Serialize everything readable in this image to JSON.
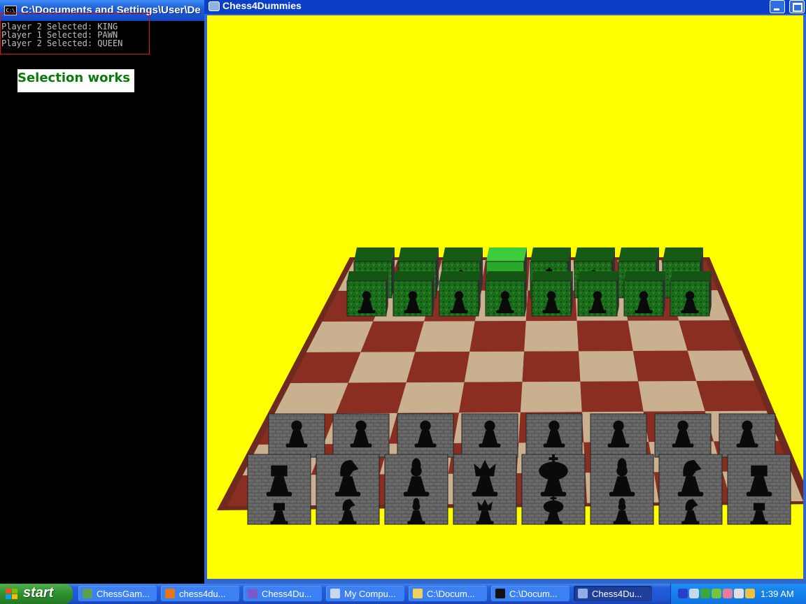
{
  "console": {
    "title": "C:\\Documents and Settings\\User\\De",
    "icon_label": "C:\\",
    "lines": [
      "Player 2 Selected: KING",
      "Player 1 Selected: PAWN",
      "Player 2 Selected: QUEEN"
    ],
    "annotation": "Selection works"
  },
  "chess_window": {
    "title": "Chess4Dummies",
    "background_color": "#ffff00",
    "board": {
      "light_square": "#c9b08e",
      "dark_square": "#8a2e22",
      "player1_color": "#1a6b1a",
      "player2_color": "#6a6a6a",
      "back_rank": [
        "rook",
        "knight",
        "bishop",
        "queen",
        "king",
        "bishop",
        "knight",
        "rook"
      ],
      "selected_piece_front": "king",
      "selected_piece_back": "queen"
    }
  },
  "taskbar": {
    "start_label": "start",
    "tasks": [
      {
        "label": "ChessGam...",
        "icon": "app-icon",
        "color": "#5aa05a"
      },
      {
        "label": "chess4du...",
        "icon": "firefox-icon",
        "color": "#e5761c"
      },
      {
        "label": "Chess4Du...",
        "icon": "visual-studio-icon",
        "color": "#7a5ac8"
      },
      {
        "label": "My Compu...",
        "icon": "computer-icon",
        "color": "#c8d8f0"
      },
      {
        "label": "C:\\Docum...",
        "icon": "folder-icon",
        "color": "#f2d060"
      },
      {
        "label": "C:\\Docum...",
        "icon": "console-icon",
        "color": "#111111"
      },
      {
        "label": "Chess4Du...",
        "icon": "window-icon",
        "color": "#8fb0e8"
      }
    ],
    "active_task_index": 6,
    "tray_icons": [
      "network-icon",
      "monitor-icon",
      "shield-icon",
      "antivirus-icon",
      "messenger-icon",
      "printer-icon",
      "volume-icon"
    ],
    "clock": "1:39 AM"
  }
}
